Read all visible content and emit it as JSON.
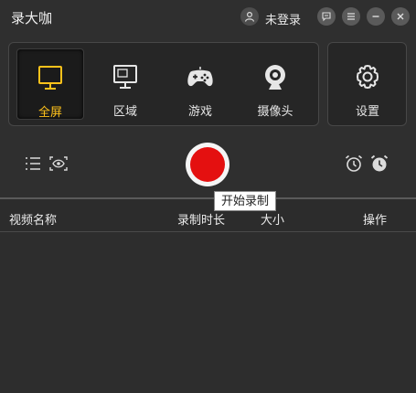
{
  "app": {
    "title": "录大咖"
  },
  "header": {
    "login_label": "未登录"
  },
  "modes": [
    {
      "label": "全屏",
      "icon": "monitor-icon",
      "active": true
    },
    {
      "label": "区域",
      "icon": "region-monitor-icon",
      "active": false
    },
    {
      "label": "游戏",
      "icon": "gamepad-icon",
      "active": false
    },
    {
      "label": "摄像头",
      "icon": "webcam-icon",
      "active": false
    }
  ],
  "settings": {
    "label": "设置",
    "icon": "gear-icon"
  },
  "record": {
    "tooltip": "开始录制"
  },
  "list": {
    "columns": [
      "视频名称",
      "录制时长",
      "大小",
      "操作"
    ],
    "rows": []
  },
  "colors": {
    "accent": "#ffc21b",
    "record": "#e41010",
    "background": "#2f2f2f"
  }
}
